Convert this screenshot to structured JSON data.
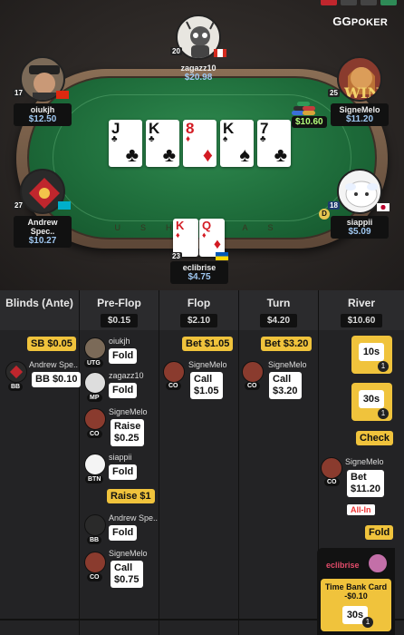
{
  "brand": {
    "logo_gg": "GG",
    "logo_poker": "POKER"
  },
  "board_cards": [
    {
      "rank": "J",
      "suit": "♣",
      "color": "black"
    },
    {
      "rank": "K",
      "suit": "♣",
      "color": "black"
    },
    {
      "rank": "8",
      "suit": "♦",
      "color": "red"
    },
    {
      "rank": "K",
      "suit": "♠",
      "color": "black"
    },
    {
      "rank": "7",
      "suit": "♣",
      "color": "black"
    }
  ],
  "pot": {
    "amount": "$10.60"
  },
  "felt_text": "USHAKAS",
  "seats": [
    {
      "name": "zagazz10",
      "stack": "$20.98",
      "level": "20"
    },
    {
      "name": "oiukjh",
      "stack": "$12.50",
      "level": "17"
    },
    {
      "name": "SigneMelo",
      "stack": "$11.20",
      "level": "25"
    },
    {
      "name": "Andrew Spec..",
      "stack": "$10.27",
      "level": "27"
    },
    {
      "name": "siappii",
      "stack": "$5.09",
      "level": "18"
    },
    {
      "name": "eclibrise",
      "stack": "$4.75",
      "level": "23"
    }
  ],
  "hero_hand": [
    {
      "rank": "K",
      "suit": "♦",
      "color": "red"
    },
    {
      "rank": "Q",
      "suit": "♦",
      "color": "red"
    }
  ],
  "history": {
    "columns": [
      {
        "title": "Blinds (Ante)",
        "value": ""
      },
      {
        "title": "Pre-Flop",
        "value": "$0.15"
      },
      {
        "title": "Flop",
        "value": "$2.10"
      },
      {
        "title": "Turn",
        "value": "$4.20"
      },
      {
        "title": "River",
        "value": "$10.60"
      }
    ],
    "blinds": {
      "sb": "SB $0.05",
      "bb_name": "Andrew Spe..",
      "bb": "BB $0.10",
      "bb_pos": "BB"
    },
    "preflop": [
      {
        "name": "oiukjh",
        "pos": "UTG",
        "action": "Fold"
      },
      {
        "name": "zagazz10",
        "pos": "MP",
        "action": "Fold"
      },
      {
        "name": "SigneMelo",
        "pos": "CO",
        "action": "Raise\n$0.25"
      },
      {
        "name": "siappii",
        "pos": "BTN",
        "action": "Fold"
      },
      {
        "name": "Andrew Spe..",
        "pos": "BB",
        "action": "Fold"
      },
      {
        "name": "SigneMelo",
        "pos": "CO",
        "action": "Call\n$0.75"
      }
    ],
    "preflop_raise": "Raise $1",
    "flop": {
      "bet": "Bet $1.05",
      "name": "SigneMelo",
      "pos": "CO",
      "action": "Call\n$1.05"
    },
    "turn": {
      "bet": "Bet $3.20",
      "name": "SigneMelo",
      "pos": "CO",
      "action": "Call\n$3.20"
    },
    "river": {
      "timer1": "10s",
      "timer1_count": "1",
      "timer2": "30s",
      "timer2_count": "1",
      "check": "Check",
      "name": "SigneMelo",
      "pos": "CO",
      "bet": "Bet\n$11.20",
      "allin": "All-In",
      "fold": "Fold"
    }
  },
  "timebank_popup": {
    "name": "eclibrise",
    "title": "Time Bank Card",
    "amount": "-$0.10",
    "timer": "30s",
    "count": "1"
  }
}
